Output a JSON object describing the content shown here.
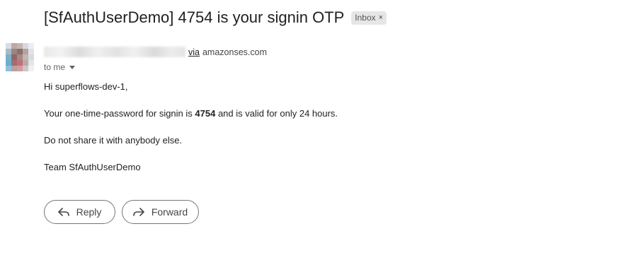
{
  "email": {
    "subject": "[SfAuthUserDemo] 4754 is your signin OTP",
    "label": "Inbox",
    "label_close": "×",
    "via_text": "via",
    "via_domain": "amazonses.com",
    "to_text": "to me",
    "body": {
      "greeting": "Hi superflows-dev-1,",
      "otp_prefix": "Your one-time-password for signin is ",
      "otp_code": "4754",
      "otp_suffix": " and is valid for only 24 hours.",
      "warning": "Do not share it with anybody else.",
      "signature": "Team SfAuthUserDemo"
    }
  },
  "actions": {
    "reply_label": "Reply",
    "forward_label": "Forward"
  },
  "icons": {
    "reply": "reply-icon",
    "forward": "forward-icon",
    "caret": "chevron-down-icon"
  }
}
